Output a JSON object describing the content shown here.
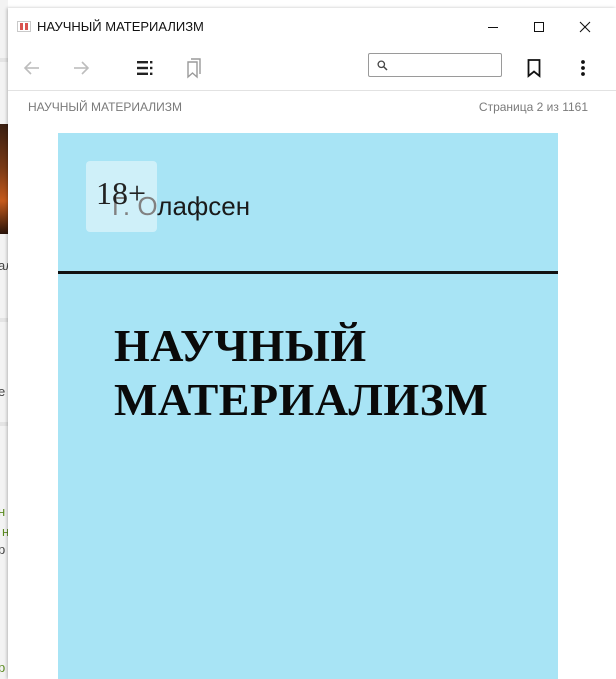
{
  "window": {
    "title": "НАУЧНЫЙ МАТЕРИАЛИЗМ",
    "minimize_glyph": "—",
    "close_glyph": "✕"
  },
  "toolbar": {
    "search_value": "",
    "search_placeholder": "",
    "icons": [
      "back-arrow-icon",
      "forward-arrow-icon",
      "contents-list-icon",
      "bookmarks-icon",
      "search-icon",
      "bookmark-icon",
      "more-vertical-icon"
    ]
  },
  "infobar": {
    "book_name": "НАУЧНЫЙ МАТЕРИАЛИЗМ",
    "page_info": "Страница 2 из 1161"
  },
  "cover": {
    "author": "Г. Олафсен",
    "age_rating": "18+",
    "title_line1": "НАУЧНЫЙ",
    "title_line2": "МАТЕРИАЛИЗМ",
    "background_color": "#a8e4f5"
  },
  "background_app": {
    "fragments": [
      "ал",
      "е",
      "н",
      "н",
      "р",
      "р"
    ]
  }
}
